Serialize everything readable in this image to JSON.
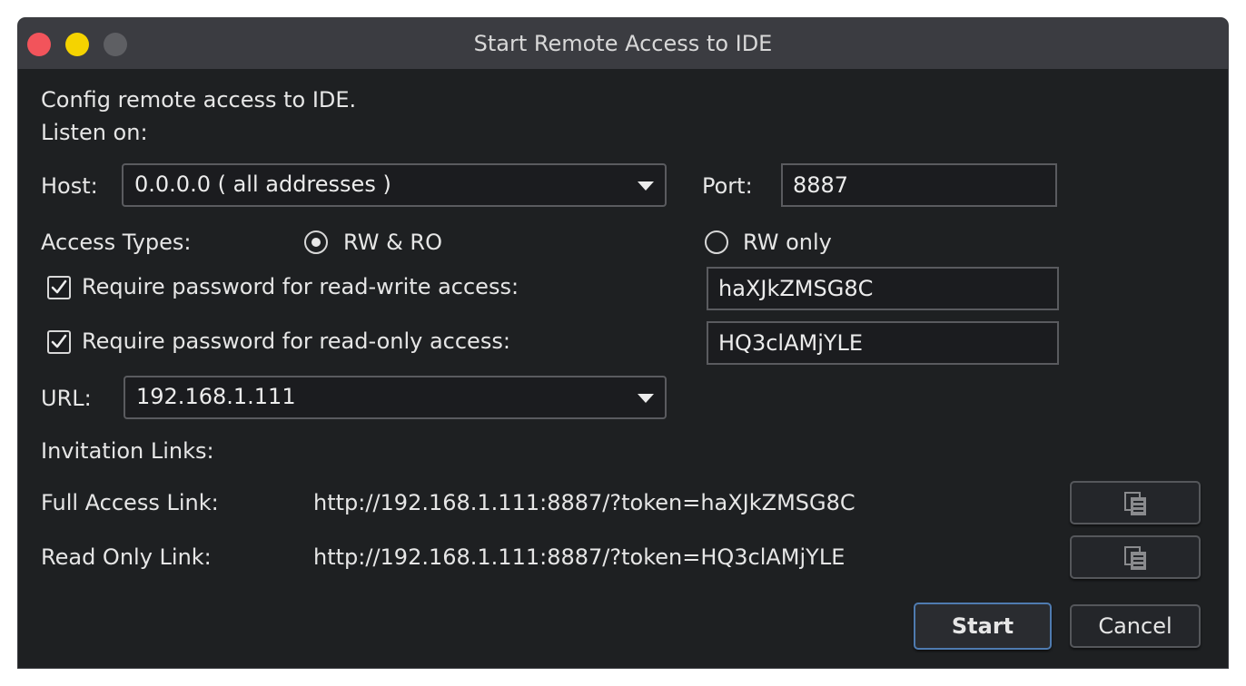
{
  "window": {
    "title": "Start Remote Access to IDE"
  },
  "intro": {
    "line1": "Config remote access to IDE.",
    "line2": "Listen on:"
  },
  "host": {
    "label": "Host:",
    "value": "0.0.0.0 ( all addresses )"
  },
  "port": {
    "label": "Port:",
    "value": "8887"
  },
  "access_types": {
    "label": "Access Types:",
    "options": [
      {
        "label": "RW & RO",
        "selected": true
      },
      {
        "label": "RW only",
        "selected": false
      }
    ]
  },
  "passwords": {
    "rw": {
      "label": "Require password for read-write access:",
      "checked": true,
      "value": "haXJkZMSG8C"
    },
    "ro": {
      "label": "Require password for read-only access:",
      "checked": true,
      "value": "HQ3clAMjYLE"
    }
  },
  "url": {
    "label": "URL:",
    "value": "192.168.1.111"
  },
  "invitation": {
    "heading": "Invitation Links:",
    "full": {
      "label": "Full Access Link:",
      "value": "http://192.168.1.111:8887/?token=haXJkZMSG8C",
      "icon": "copy-icon"
    },
    "readonly": {
      "label": "Read Only Link:",
      "value": "http://192.168.1.111:8887/?token=HQ3clAMjYLE",
      "icon": "copy-icon"
    }
  },
  "buttons": {
    "start": "Start",
    "cancel": "Cancel"
  },
  "colors": {
    "accent": "#4f7bb0",
    "close": "#f2545b",
    "minimize": "#f5d300",
    "maximize": "#5e5f63"
  }
}
